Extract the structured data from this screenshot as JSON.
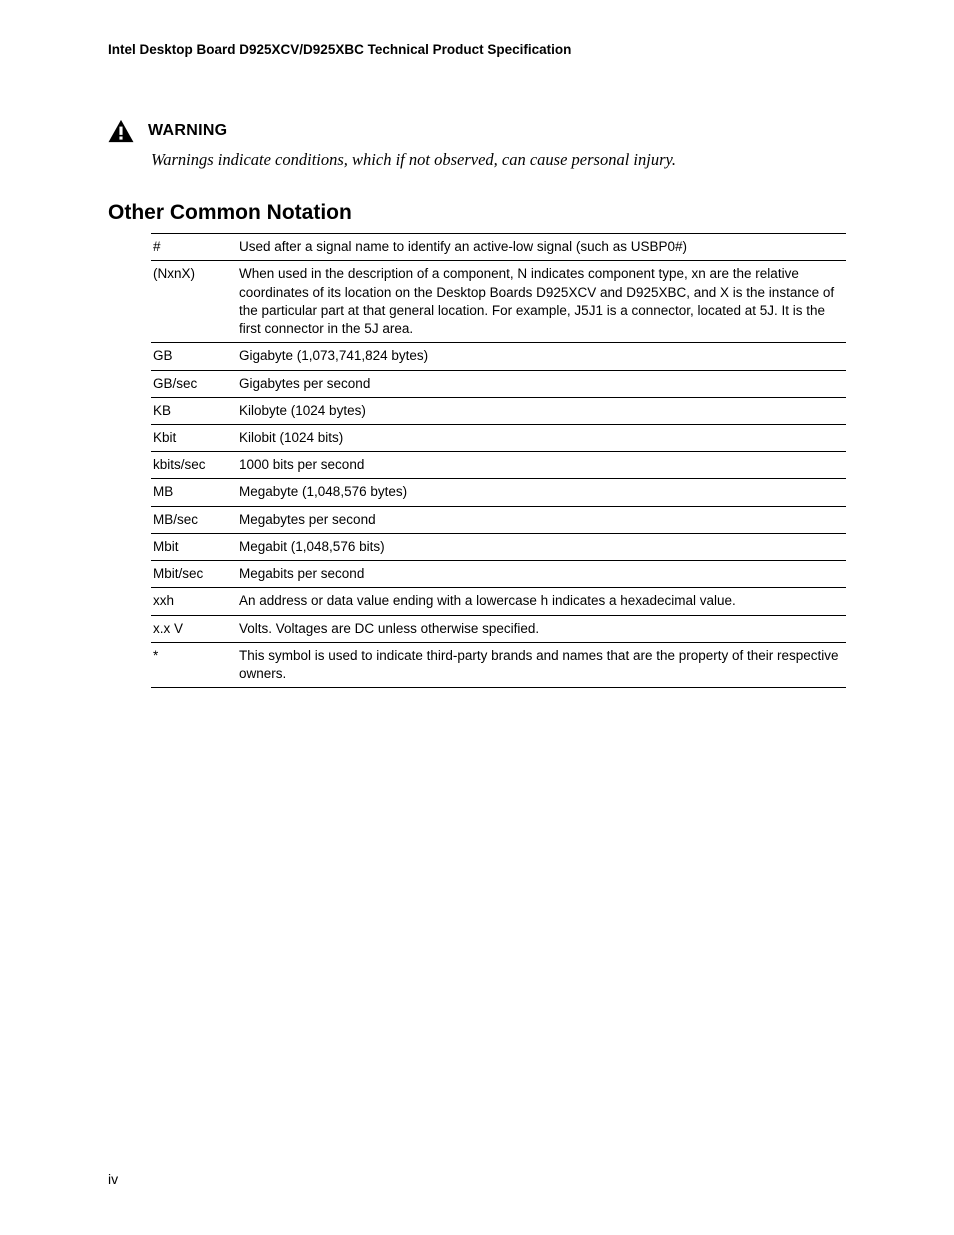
{
  "header": {
    "running_title": "Intel Desktop Board D925XCV/D925XBC Technical Product Specification"
  },
  "warning": {
    "label": "WARNING",
    "description": "Warnings indicate conditions, which if not observed, can cause personal injury."
  },
  "section": {
    "heading": "Other Common Notation"
  },
  "notation": [
    {
      "term": "#",
      "def": "Used after a signal name to identify an active-low signal (such as USBP0#)"
    },
    {
      "term": "(NxnX)",
      "def": "When used in the description of a component, N indicates component type, xn are the relative coordinates of its location on the Desktop Boards D925XCV and D925XBC, and X is the instance of the particular part at that general location.  For example, J5J1 is a connector, located at 5J.  It is the first connector in the 5J area."
    },
    {
      "term": "GB",
      "def": "Gigabyte (1,073,741,824 bytes)"
    },
    {
      "term": "GB/sec",
      "def": "Gigabytes per second"
    },
    {
      "term": "KB",
      "def": "Kilobyte (1024 bytes)"
    },
    {
      "term": "Kbit",
      "def": "Kilobit (1024 bits)"
    },
    {
      "term": "kbits/sec",
      "def": "1000 bits per second"
    },
    {
      "term": "MB",
      "def": "Megabyte (1,048,576 bytes)"
    },
    {
      "term": "MB/sec",
      "def": "Megabytes per second"
    },
    {
      "term": "Mbit",
      "def": "Megabit (1,048,576 bits)"
    },
    {
      "term": "Mbit/sec",
      "def": "Megabits per second"
    },
    {
      "term": "xxh",
      "def": "An address or data value ending with a lowercase h indicates a hexadecimal value."
    },
    {
      "term": "x.x V",
      "def": "Volts.  Voltages are DC unless otherwise specified."
    },
    {
      "term": "*",
      "def": "This symbol is used to indicate third-party brands and names that are the property of their respective owners."
    }
  ],
  "footer": {
    "page_number": "iv"
  }
}
